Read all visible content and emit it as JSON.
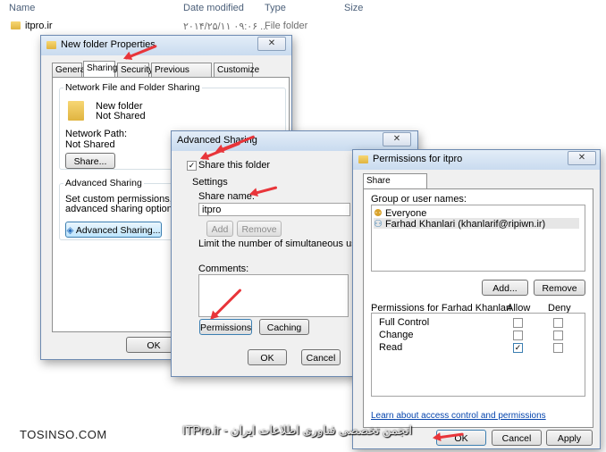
{
  "explorer": {
    "columns": {
      "name": "Name",
      "date": "Date modified",
      "type": "Type",
      "size": "Size"
    },
    "row": {
      "name": "itpro.ir",
      "date": "۲۰۱۴/۲۵/۱۱ ۰۹:۰۶ ...",
      "type": "File folder"
    }
  },
  "properties": {
    "title": "New folder Properties",
    "tabs": [
      "General",
      "Sharing",
      "Security",
      "Previous Versions",
      "Customize"
    ],
    "net_group": "Network File and Folder Sharing",
    "folder_name": "New folder",
    "folder_status": "Not Shared",
    "path_label": "Network Path:",
    "path_value": "Not Shared",
    "share_btn": "Share...",
    "adv_group": "Advanced Sharing",
    "adv_text1": "Set custom permissions, create m",
    "adv_text2": "advanced sharing options.",
    "adv_btn": "Advanced Sharing...",
    "ok": "OK"
  },
  "advanced": {
    "title": "Advanced Sharing",
    "share_checkbox": "Share this folder",
    "settings": "Settings",
    "share_name_label": "Share name:",
    "share_name_value": "itpro",
    "add": "Add",
    "remove": "Remove",
    "limit": "Limit the number of simultaneous users to:",
    "comments": "Comments:",
    "permissions": "Permissions",
    "caching": "Caching",
    "ok": "OK",
    "cancel": "Cancel"
  },
  "permissions": {
    "title": "Permissions for itpro",
    "tab": "Share Permissions",
    "group_label": "Group or user names:",
    "users": [
      "Everyone",
      "Farhad Khanlari (khanlarif@ripiwn.ir)"
    ],
    "add": "Add...",
    "remove": "Remove",
    "perm_label": "Permissions for Farhad Khanlari",
    "allow": "Allow",
    "deny": "Deny",
    "rows": [
      {
        "name": "Full Control",
        "allow": "",
        "deny": ""
      },
      {
        "name": "Change",
        "allow": "",
        "deny": ""
      },
      {
        "name": "Read",
        "allow": "✓",
        "deny": ""
      }
    ],
    "link": "Learn about access control and permissions",
    "ok": "OK",
    "cancel": "Cancel",
    "apply": "Apply"
  },
  "watermark": {
    "left": "TOSINSO.COM",
    "right": "ITPro.ir - انجمن تخصصی فناوری اطلاعات ایران"
  }
}
